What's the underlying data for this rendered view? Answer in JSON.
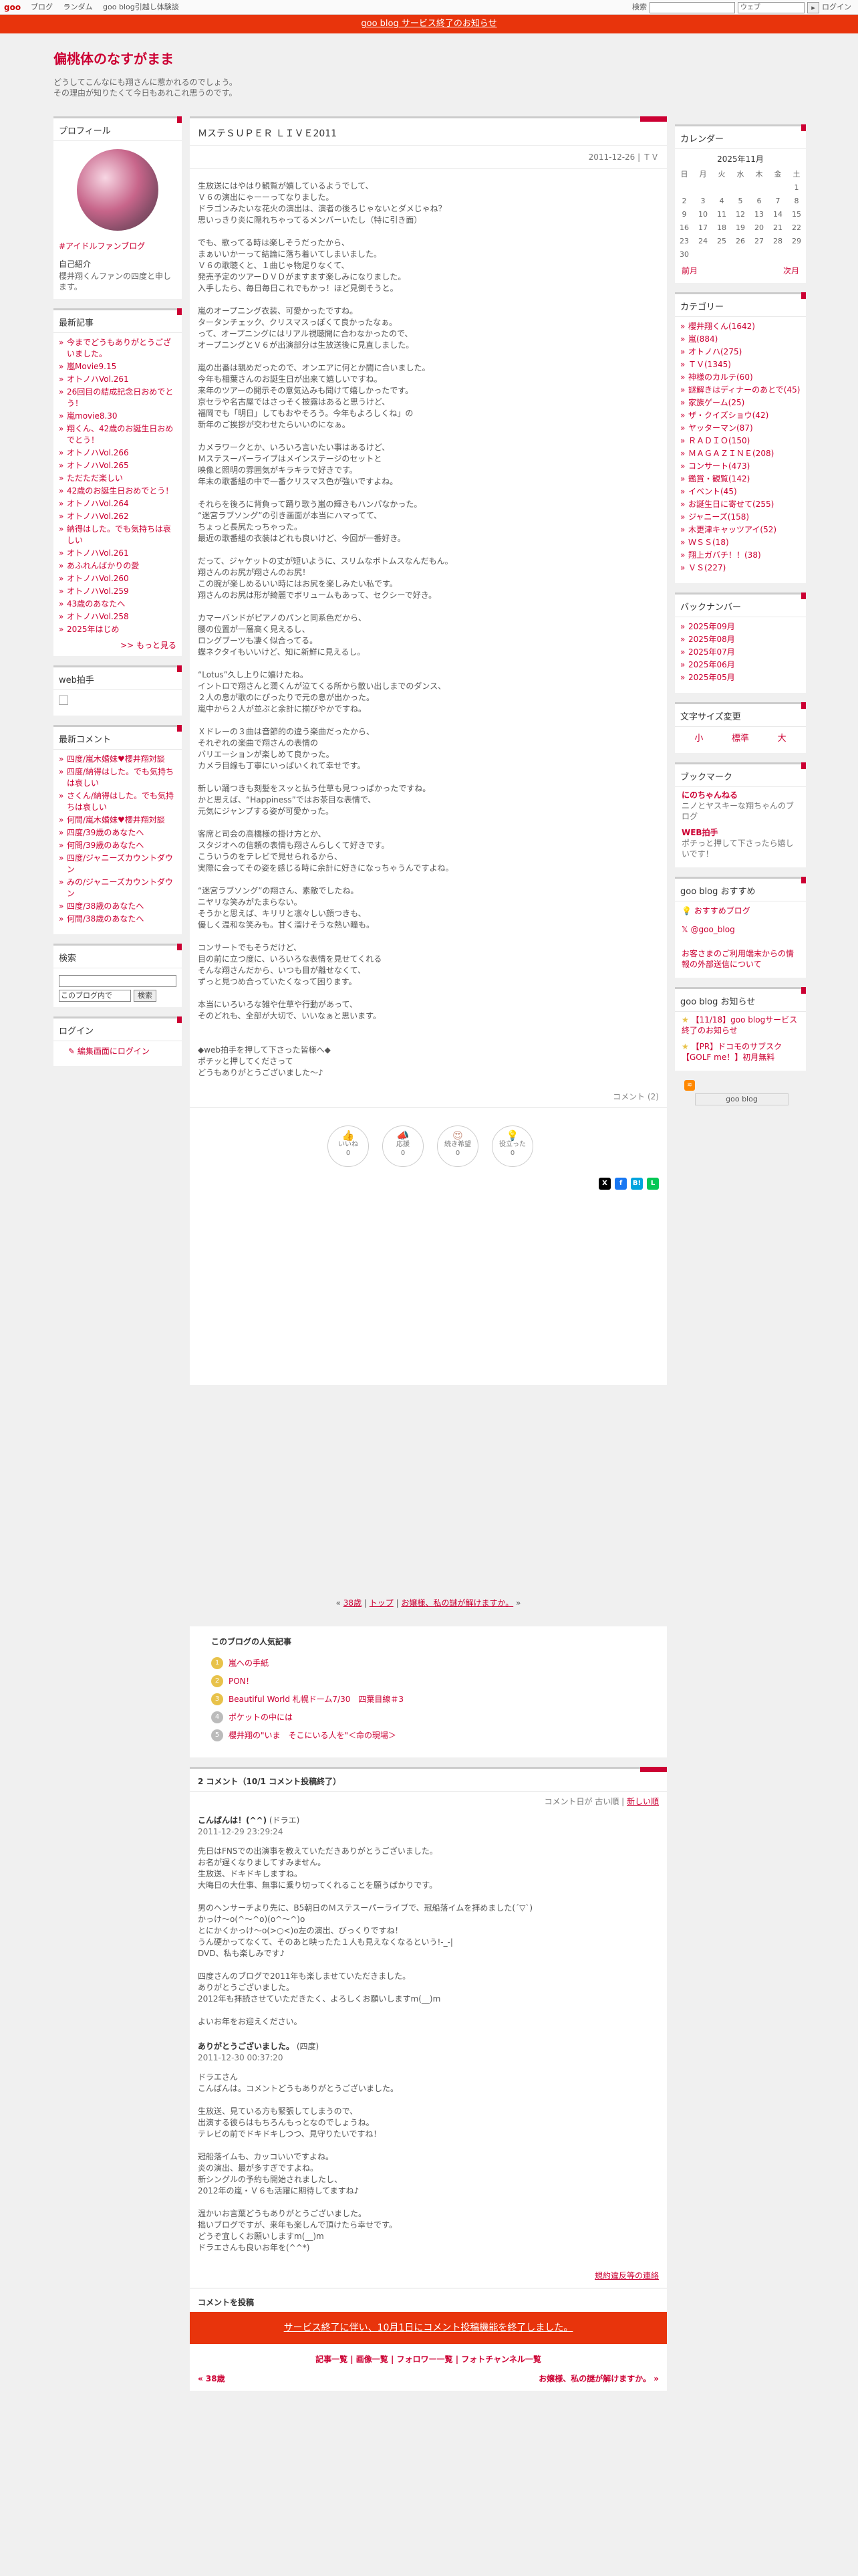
{
  "topbar": {
    "logo": "goo",
    "links": [
      "ブログ",
      "ランダム",
      "goo blog引越し体験談"
    ],
    "search_label": "検索",
    "search_type": "ウェブ",
    "login": "ログイン"
  },
  "notice": "goo blog サービス終了のお知らせ",
  "blog": {
    "title": "偏桃体のなすがまま",
    "description": "どうしてこんなにも翔さんに惹かれるのでしょう。\nその理由が知りたくて今日もあれこれ思うのです。"
  },
  "left": {
    "profile": {
      "heading": "プロフィール",
      "link": "#アイドルファンブログ",
      "intro_label": "自己紹介",
      "intro": "櫻井翔くんファンの四度と申します。"
    },
    "recent": {
      "heading": "最新記事",
      "items": [
        "今までどうもありがとうございました。",
        "嵐Movie9.15",
        "オトノハVol.261",
        "26回目の結成記念日おめでとう！",
        "嵐movie8.30",
        "翔くん、42歳のお誕生日おめでとう！",
        "オトノハVol.266",
        "オトノハVol.265",
        "ただただ楽しい",
        "42歳のお誕生日おめでとう！",
        "オトノハVol.264",
        "オトノハVol.262",
        "納得はした。でも気持ちは哀しい",
        "オトノハVol.261",
        "あふれんばかりの愛",
        "オトノハVol.260",
        "オトノハVol.259",
        "43歳のあなたへ",
        "オトノハVol.258",
        "2025年はじめ"
      ],
      "more": ">> もっと見る"
    },
    "web_clap": {
      "heading": "web拍手"
    },
    "latest_comments": {
      "heading": "最新コメント",
      "items": [
        "四度/嵐木婚妹♥櫻井翔対談",
        "四度/納得はした。でも気持ちは哀しい",
        "さくん/納得はした。でも気持ちは哀しい",
        "何問/嵐木婚妹♥櫻井翔対談",
        "四度/39歳のあなたへ",
        "何問/39歳のあなたへ",
        "四度/ジャニーズカウントダウン",
        "みの/ジャニーズカウントダウン",
        "四度/38歳のあなたへ",
        "何問/38歳のあなたへ"
      ]
    },
    "search": {
      "heading": "検索",
      "select": "このブログ内で",
      "button": "検索"
    },
    "login": {
      "heading": "ログイン",
      "link": "編集画面にログイン"
    }
  },
  "right": {
    "calendar": {
      "heading": "カレンダー",
      "month": "2025年11月",
      "weekdays": [
        "日",
        "月",
        "火",
        "水",
        "木",
        "金",
        "土"
      ],
      "weeks": [
        [
          "",
          "",
          "",
          "",
          "",
          "",
          "1"
        ],
        [
          "2",
          "3",
          "4",
          "5",
          "6",
          "7",
          "8"
        ],
        [
          "9",
          "10",
          "11",
          "12",
          "13",
          "14",
          "15"
        ],
        [
          "16",
          "17",
          "18",
          "19",
          "20",
          "21",
          "22"
        ],
        [
          "23",
          "24",
          "25",
          "26",
          "27",
          "28",
          "29"
        ],
        [
          "30",
          "",
          "",
          "",
          "",
          "",
          ""
        ]
      ],
      "prev": "前月",
      "next": "次月"
    },
    "categories": {
      "heading": "カテゴリー",
      "items": [
        "櫻井翔くん(1642)",
        "嵐(884)",
        "オトノハ(275)",
        "ＴＶ(1345)",
        "神様のカルテ(60)",
        "謎解きはディナーのあとで(45)",
        "家族ゲーム(25)",
        "ザ・クイズショウ(42)",
        "ヤッターマン(87)",
        "ＲＡＤＩＯ(150)",
        "ＭＡＧＡＺＩＮＥ(208)",
        "コンサート(473)",
        "鑑賞・観覧(142)",
        "イベント(45)",
        "お誕生日に寄せて(255)",
        "ジャニーズ(158)",
        "木更津キャッツアイ(52)",
        "ＷＳＳ(18)",
        "翔上ガバチ！！(38)",
        "ＶＳ(227)"
      ]
    },
    "backnumber": {
      "heading": "バックナンバー",
      "items": [
        "2025年09月",
        "2025年08月",
        "2025年07月",
        "2025年06月",
        "2025年05月"
      ]
    },
    "textsize": {
      "heading": "文字サイズ変更",
      "small": "小",
      "medium": "標準",
      "large": "大"
    },
    "bookmark": {
      "heading": "ブックマーク",
      "items": [
        {
          "title": "にのちゃんねる",
          "desc": "ニノとヤスキーな翔ちゃんのブログ"
        },
        {
          "title": "WEB拍手",
          "desc": "ポチっと押して下さったら嬉しいです！"
        }
      ]
    },
    "recommend": {
      "heading": "goo blog おすすめ",
      "items": [
        "おすすめブログ",
        "@goo_blog"
      ],
      "notice": "お客さまのご利用端末からの情報の外部送信について"
    },
    "news": {
      "heading": "goo blog お知らせ",
      "items": [
        "【11/18】goo blogサービス終了のお知らせ",
        "【PR】ドコモのサブスク【GOLF me！】初月無料"
      ]
    },
    "goo_badge": "goo blog"
  },
  "entry": {
    "title": "ＭステＳＵＰＥＲ ＬＩＶＥ2011",
    "date": "2011-12-26 | ＴＶ",
    "body": "生放送にはやはり観覧が嬉しているようでして、\nＶ６の演出にゃーーってなりました。\nドラゴンみたいな花火の演出は、演者の後ろじゃないとダメじゃね？\n思いっきり炎に隠れちゃってるメンバーいたし（特に引き面）\n\nでも、歌ってる時は楽しそうだったから、\nまぁいいかーって結論に落ち着いてしまいました。\nＶ６の歌聴くと、１曲じゃ物足りなくて、\n発売予定のツアーＤＶＤがますます楽しみになりました。\n入手したら、毎日毎日これでもかっ！ほど見倒そうと。\n\n嵐のオープニング衣装、可愛かったですね。\nタータンチェック、クリスマスっぽくて良かったなぁ。\nって、オープニングにはリアル視聴開に合わなかったので、\nオープニングとＶ６が出演部分は生放送後に見直しました。\n\n嵐の出番は親めだったので、オンエアに何とか間に合いました。\n今年も相葉さんのお誕生日が出来て嬉しいですね。\n来年のツアーの開示その意気込みも聞けて嬉しかったです。\n京セラや名古屋ではさっそく披露はあると思うけど、\n福岡でも「明日」してもおやそろう。今年もよろしくね」の\n新年のご挨拶が交わせたらいいのになぁ。\n\nカメラワークとか、いろいろ言いたい事はあるけど、\nＭステスーパーライブはメインステージのセットと\n映像と照明の雰囲気がキラキラで好きです。\n年末の歌番組の中で一番クリスマス色が強いですよね。\n\nそれらを後ろに背負って踊り歌う嵐の輝きもハンパなかった。\n“迷宮ラブソング”の引き画面が本当にハマってて、\nちょっと長尻たっちゃった。\n最近の歌番組の衣装はどれも良いけど、今回が一番好き。\n\nだって、ジャケットの丈が短いように、スリムなボトムスなんだもん。\n翔さんのお尻が翔さんのお尻！\nこの腕が楽しめるいい時にはお尻を楽しみたい私です。\n翔さんのお尻は形が綺麗でボリュームもあって、セクシーで好き。\n\nカマーバンドがピアノのパンと同系色だから、\n腰の位置が一層高く見えるし、\nロングブーツも凄く似合ってる。\n蝶ネクタイもいいけど、知に新鮮に見えるし。\n\n“Lotus”久し上りに嬉けたね。\nイントロで翔さんと潤くんが泣てくる所から散い出しまでのダンス、\n２人の息が歌のにぴったりで元の息が出かった。\n嵐中から２人が並ぶと余計に揃びやかですね。\n\nＸドレーの３曲は音節的の違う楽曲だったから、\nそれぞれの楽曲で翔さんの表情の\nバリエーションが楽しめて良かった。\nカメラ目線も丁寧にいっぱいくれて幸せです。\n\n新しい踊つきも刻髪をスッと払う仕草も見つっぱかったですね。\nかと思えば、“Happiness”ではお茶目な表情で、\n元気にジャンプする姿が可愛かった。\n\n客席と司会の高橋様の掛け方とか、\nスタジオへの信頼の表情も翔さんらしくて好きです。\nこういうのをテレビで見せられるから、\n実際に会ってその姿を感じる時に余計に好きになっちゃうんですよね。\n\n“迷宮ラブソング”の翔さん、素敵でしたね。\nニヤリな笑みがたまらない。\nそうかと思えば、キリリと凛々しい顔つきも、\n優しく温和な笑みも。甘く溜けそうな熱い瞳も。\n\nコンサートでもそうだけど、\n目の前に立つ度に、いろいろな表情を見せてくれる\nそんな翔さんだから、いつも目が離せなくて、\nずっと見つめ合っていたくなって困ります。\n\n本当にいろいろな雑や仕草や行動があって、\nそのどれも、全部が大切で、いいなぁと思います。\n\n\n◆web拍手を押して下さった皆様へ◆\nポチッと押してくださって\nどうもありがとうございました〜♪",
    "comment_count": "コメント (2)",
    "reactions": [
      {
        "label": "いいね",
        "count": "0"
      },
      {
        "label": "応援",
        "count": "0"
      },
      {
        "label": "続き希望",
        "count": "0"
      },
      {
        "label": "役立った",
        "count": "0"
      }
    ],
    "share": [
      "X",
      "f",
      "B!",
      "L"
    ]
  },
  "pager": {
    "prev": "38歳",
    "top": "トップ",
    "next": "お嬢様、私の謎が解けますか。"
  },
  "popular": {
    "heading": "このブログの人気記事",
    "items": [
      "嵐への手紙",
      "PON！",
      "Beautiful World 札幌ドーム7/30　四葉目線＃3",
      "ポケットの中には",
      "櫻井翔の\"いま　そこにいる人を\"＜命の現場＞"
    ]
  },
  "comments": {
    "heading": "2 コメント（10/1 コメント投稿終了）",
    "sort": {
      "label": "コメント日が",
      "old": "古い順",
      "new": "新しい順"
    },
    "items": [
      {
        "author": "こんばんは！(^^)",
        "author_suffix": "(ドラエ)",
        "date": "2011-12-29 23:29:24",
        "body": "先日はFNSでの出演事を教えていただきありがとうございました。\nお名が遅くなりましてすみません。\n生放送、ドキドキしますね。\n大晦日の大仕事、無事に乗り切ってくれることを願うばかりです。\n\n男のヘンサーチより先に、B5朝日のＭステスーパーライブで、冠船落イムを拝めました(´▽`)\nかっけ〜o(^〜^o)(o^〜^)o\nとにかくかっけ〜o(>○<)o左の演出、びっくりですね！\nうん硬かってなくて、そのあと映ったた１人も見えなくなるという!-_-|\nDVD、私も楽しみです♪\n\n四度さんのブログで2011年も楽しませていただきました。\nありがとうございました。\n2012年も拝読させていただきたく、よろしくお願いしますm(__)m\n\nよいお年をお迎えください。"
      },
      {
        "author": "ありがとうございました。",
        "author_suffix": "(四度)",
        "date": "2011-12-30 00:37:20",
        "body": "ドラエさん\nこんばんは。コメントどうもありがとうございました。\n\n生放送、見ている方も緊張してしまうので、\n出演する彼らはもちろんもっとなのでしょうね。\nテレビの前でドキドキしつつ、見守りたいですね！\n\n冠船落イムも、カッコいいですよね。\n炎の演出、最が多すぎですよね。\n新シングルの予約も開始されましたし、\n2012年の嵐・Ｖ６も活躍に期待してますね♪\n\n温かいお言葉どうもありがとうございました。\n拙いブログですが、来年も楽しんで頂けたら幸せです。\nどうぞ宜しくお願いしますm(__)m\nドラエさんも良いお年を(^^*)"
      }
    ],
    "rules": "規約違反等の連絡",
    "post_heading": "コメントを投稿",
    "closed": "サービス終了に伴い、10月1日にコメント投稿機能を終了しました。"
  },
  "footer": {
    "links": "記事一覧 | 画像一覧 | フォロワー一覧 | フォトチャンネル一覧",
    "prev": "« 38歳",
    "next": "お嬢様、私の謎が解けますか。 »"
  }
}
